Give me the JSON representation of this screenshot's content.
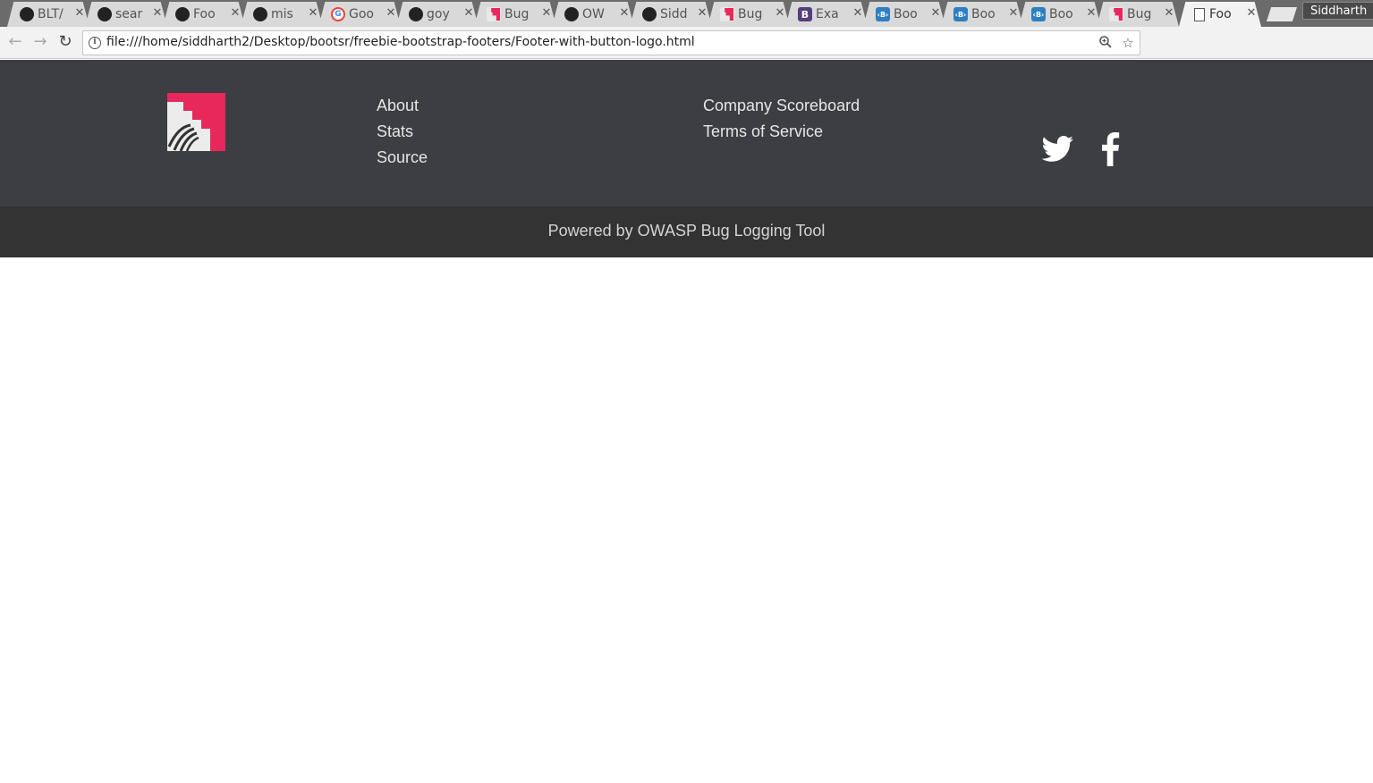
{
  "browser": {
    "tabs": [
      {
        "title": "BLT/",
        "favicon": "github-icon"
      },
      {
        "title": "sear",
        "favicon": "github-icon"
      },
      {
        "title": "Foo",
        "favicon": "github-icon"
      },
      {
        "title": "mis",
        "favicon": "github-icon"
      },
      {
        "title": "Goo",
        "favicon": "google-icon"
      },
      {
        "title": "goy",
        "favicon": "github-icon"
      },
      {
        "title": "Bug",
        "favicon": "bug-logo-icon"
      },
      {
        "title": "OW",
        "favicon": "github-icon"
      },
      {
        "title": "Sidd",
        "favicon": "github-icon"
      },
      {
        "title": "Bug",
        "favicon": "bug-logo-icon"
      },
      {
        "title": "Exa",
        "favicon": "bootstrap-icon"
      },
      {
        "title": "Boo",
        "favicon": "bootsnipp-icon"
      },
      {
        "title": "Boo",
        "favicon": "bootsnipp-icon"
      },
      {
        "title": "Boo",
        "favicon": "bootsnipp-icon"
      },
      {
        "title": "Bug",
        "favicon": "bug-logo-icon"
      },
      {
        "title": "Foo",
        "favicon": "document-icon",
        "active": true
      }
    ],
    "profile_name": "Siddharth",
    "url": "file:///home/siddharth2/Desktop/bootsr/freebie-bootstrap-footers/Footer-with-button-logo.html",
    "extensions": [
      "m-icon",
      "mail-icon",
      "opera-icon",
      "trello-icon",
      "bw-icon",
      "orange-x-icon",
      "lock-icon"
    ]
  },
  "footer": {
    "links_col1": [
      "About",
      "Stats",
      "Source"
    ],
    "links_col2": [
      "Company Scoreboard",
      "Terms of Service"
    ],
    "social": [
      "twitter-icon",
      "facebook-icon"
    ],
    "powered_by": "Powered by OWASP Bug Logging Tool",
    "colors": {
      "top_bg": "#3d3e43",
      "bottom_bg": "#333333",
      "logo_red": "#e8275b",
      "link": "#e6e6e6"
    }
  }
}
